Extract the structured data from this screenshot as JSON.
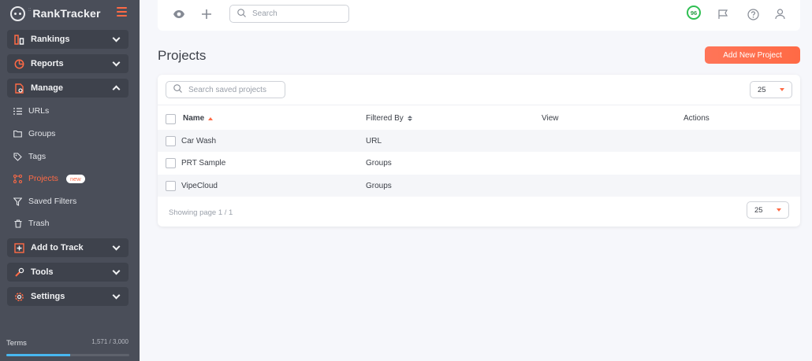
{
  "app": {
    "logo_small": "::",
    "logo_text": "RankTracker"
  },
  "sidebar": {
    "groups": {
      "rankings": "Rankings",
      "reports": "Reports",
      "manage": "Manage",
      "add_to_track": "Add to Track",
      "tools": "Tools",
      "settings": "Settings"
    },
    "items": {
      "urls": "URLs",
      "groups": "Groups",
      "tags": "Tags",
      "projects": "Projects",
      "projects_badge": "new",
      "saved_filters": "Saved Filters",
      "trash": "Trash"
    },
    "footer": {
      "terms": "Terms",
      "usage": "1,571 / 3,000",
      "usage_fraction": 0.52
    }
  },
  "topbar": {
    "search_placeholder": "Search",
    "score": "96"
  },
  "page": {
    "title": "Projects",
    "add_button": "Add New Project"
  },
  "table": {
    "search_placeholder": "Search saved projects",
    "per_page": "25",
    "columns": {
      "name": "Name",
      "filtered_by": "Filtered By",
      "view": "View",
      "actions": "Actions"
    },
    "rows": [
      {
        "name": "Car Wash",
        "filtered_by": "URL",
        "view": "",
        "actions": ""
      },
      {
        "name": "PRT Sample",
        "filtered_by": "Groups",
        "view": "",
        "actions": ""
      },
      {
        "name": "VipeCloud",
        "filtered_by": "Groups",
        "view": "",
        "actions": ""
      }
    ],
    "footer_text": "Showing page 1 / 1",
    "footer_per_page": "25"
  },
  "colors": {
    "accent": "#ff6a45",
    "sidebar_bg": "#4a4e59",
    "score_green": "#2fbf52",
    "usage_bar": "#48b7f0"
  }
}
